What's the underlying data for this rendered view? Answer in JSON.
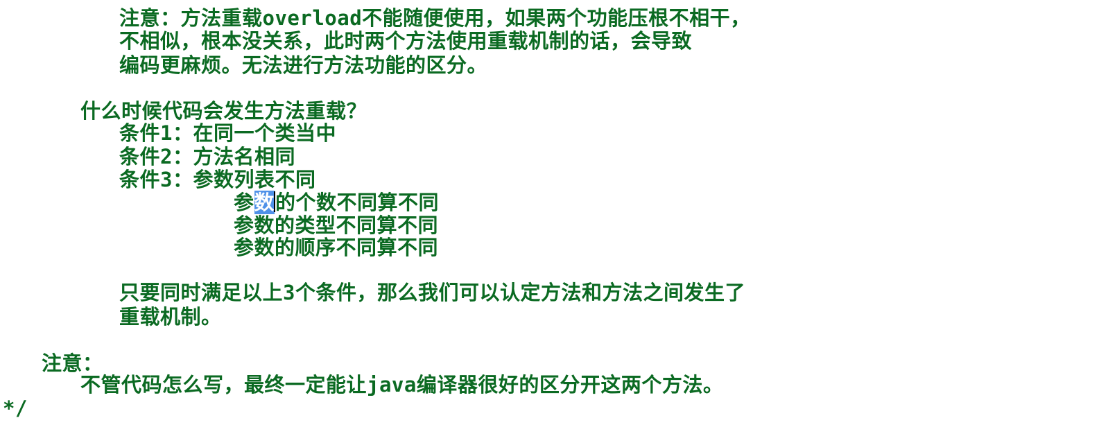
{
  "editor": {
    "lines": [
      "注意：方法重载overload不能随便使用，如果两个功能压根不相干，",
      "不相似，根本没关系，此时两个方法使用重载机制的话，会导致",
      "编码更麻烦。无法进行方法功能的区分。",
      "什么时候代码会发生方法重载？",
      "条件1：在同一个类当中",
      "条件2：方法名相同",
      "条件3：参数列表不同",
      "参",
      "数",
      "的个数不同算不同",
      "参数的类型不同算不同",
      "参数的顺序不同算不同",
      "只要同时满足以上3个条件，那么我们可以认定方法和方法之间发生了",
      "重载机制。",
      "注意：",
      "不管代码怎么写，最终一定能让java编译器很好的区分开这两个方法。",
      "*/"
    ]
  },
  "colors": {
    "text": "#0b6a22",
    "selection": "#4f91e8",
    "background": "#ffffff"
  }
}
